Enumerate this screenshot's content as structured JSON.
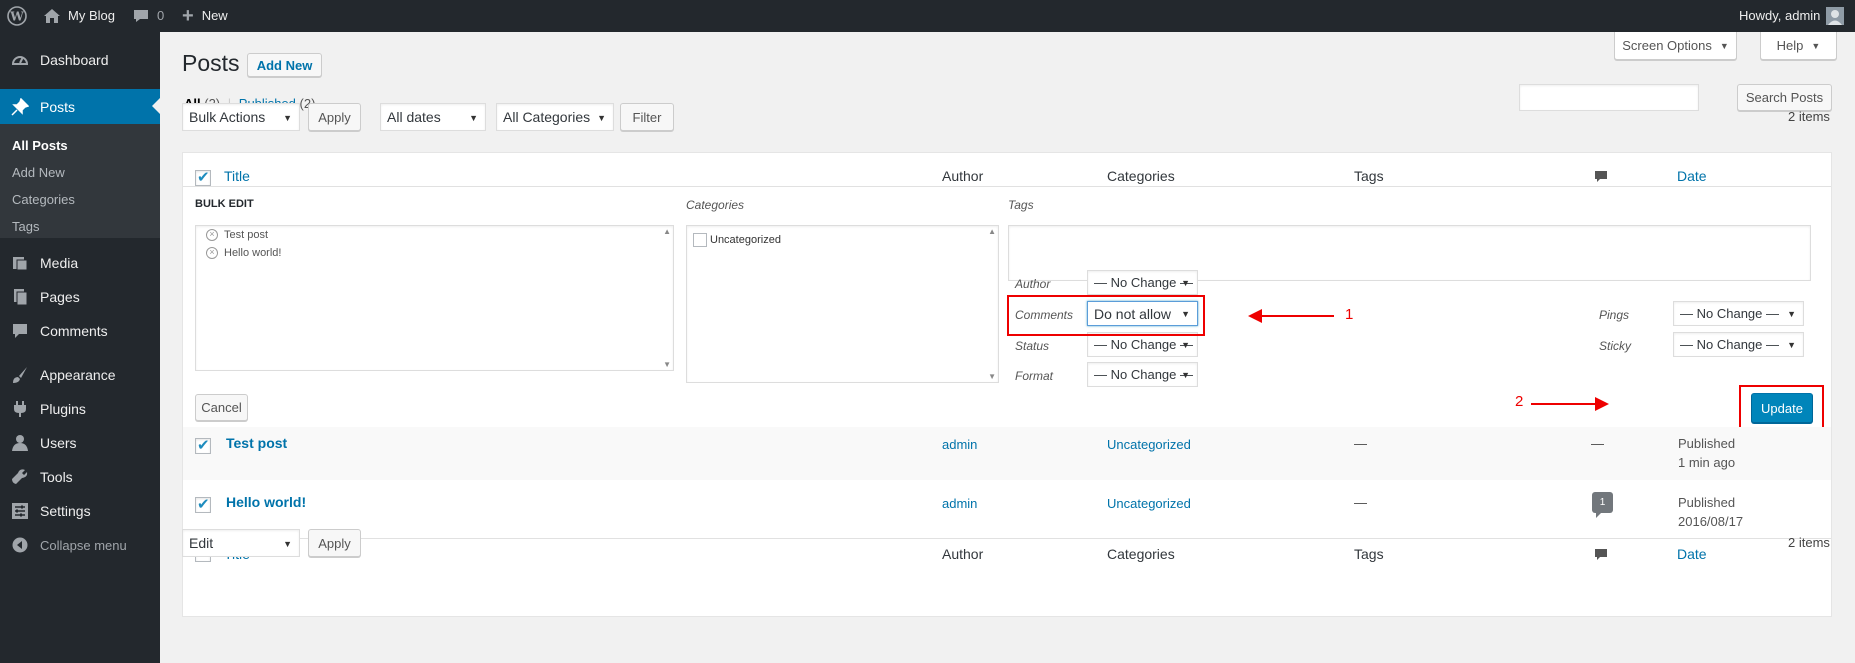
{
  "adminbar": {
    "site_name": "My Blog",
    "comments_count": "0",
    "new_label": "New",
    "howdy": "Howdy, admin"
  },
  "sidebar": {
    "items": [
      "Dashboard",
      "Posts",
      "Media",
      "Pages",
      "Comments",
      "Appearance",
      "Plugins",
      "Users",
      "Tools",
      "Settings",
      "Collapse menu"
    ],
    "submenu": [
      "All Posts",
      "Add New",
      "Categories",
      "Tags"
    ]
  },
  "header": {
    "title": "Posts",
    "add_new": "Add New",
    "screen_options": "Screen Options",
    "help": "Help"
  },
  "views": {
    "all": "All",
    "all_count": "(2)",
    "sep": "|",
    "published": "Published",
    "published_count": "(2)"
  },
  "search": {
    "button": "Search Posts"
  },
  "filters": {
    "bulk_actions": "Bulk Actions",
    "apply": "Apply",
    "dates": "All dates",
    "categories": "All Categories",
    "filter": "Filter",
    "items_count": "2 items"
  },
  "columns": {
    "title": "Title",
    "author": "Author",
    "categories": "Categories",
    "tags": "Tags",
    "date": "Date"
  },
  "bulk_edit": {
    "heading": "BULK EDIT",
    "posts": [
      "Test post",
      "Hello world!"
    ],
    "categories_label": "Categories",
    "category_item": "Uncategorized",
    "tags_label": "Tags",
    "author_label": "Author",
    "author_value": "— No Change —",
    "comments_label": "Comments",
    "comments_value": "Do not allow",
    "status_label": "Status",
    "status_value": "— No Change —",
    "format_label": "Format",
    "format_value": "— No Change —",
    "pings_label": "Pings",
    "pings_value": "— No Change —",
    "sticky_label": "Sticky",
    "sticky_value": "— No Change —",
    "cancel": "Cancel",
    "update": "Update",
    "annotation_1": "1",
    "annotation_2": "2"
  },
  "rows": [
    {
      "title": "Test post",
      "author": "admin",
      "category": "Uncategorized",
      "tags": "—",
      "comments": "—",
      "status": "Published",
      "date": "1 min ago"
    },
    {
      "title": "Hello world!",
      "author": "admin",
      "category": "Uncategorized",
      "tags": "—",
      "comments": "1",
      "status": "Published",
      "date": "2016/08/17"
    }
  ],
  "bottom": {
    "action": "Edit",
    "apply": "Apply",
    "items_count": "2 items"
  }
}
